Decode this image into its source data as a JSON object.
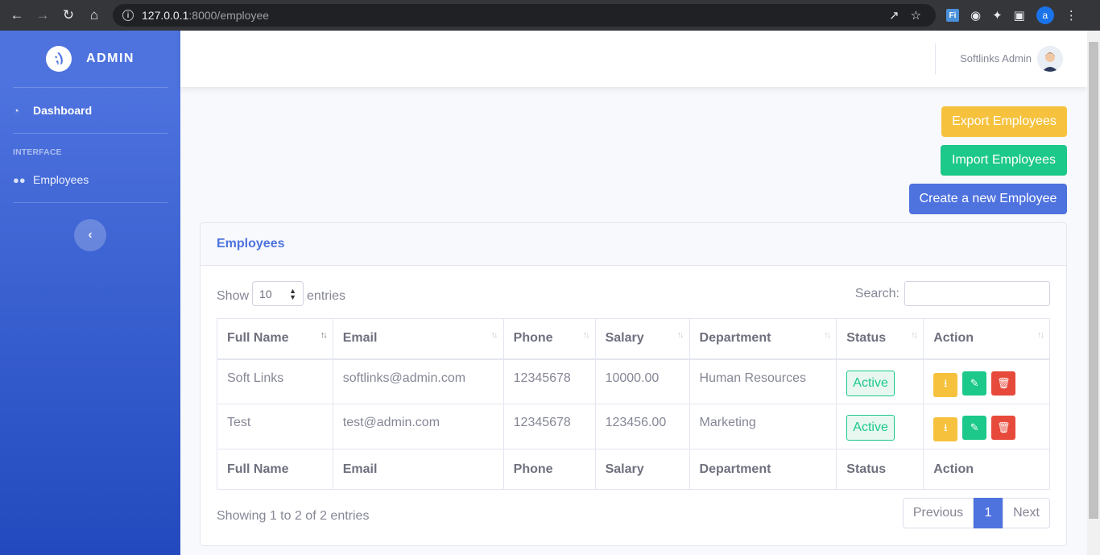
{
  "browser": {
    "url_host": "127.0.0.1",
    "url_path": ":8000/employee"
  },
  "sidebar": {
    "brand": "ADMIN",
    "nav": [
      {
        "label": "Dashboard",
        "icon": "dashboard-icon"
      },
      {
        "label": "Employees",
        "icon": "users-icon"
      }
    ],
    "section_heading": "INTERFACE"
  },
  "topbar": {
    "username": "Softlinks Admin"
  },
  "actions": {
    "export": "Export Employees",
    "import": "Import Employees",
    "create": "Create a new Employee"
  },
  "card": {
    "title": "Employees",
    "show_label": "Show",
    "entries_value": "10",
    "entries_label": "entries",
    "search_label": "Search:"
  },
  "table": {
    "columns": [
      "Full Name",
      "Email",
      "Phone",
      "Salary",
      "Department",
      "Status",
      "Action"
    ],
    "rows": [
      {
        "full_name": "Soft Links",
        "email": "softlinks@admin.com",
        "phone": "12345678",
        "salary": "10000.00",
        "department": "Human Resources",
        "status": "Active"
      },
      {
        "full_name": "Test",
        "email": "test@admin.com",
        "phone": "12345678",
        "salary": "123456.00",
        "department": "Marketing",
        "status": "Active"
      }
    ]
  },
  "footer": {
    "info": "Showing 1 to 2 of 2 entries",
    "previous": "Previous",
    "page": "1",
    "next": "Next"
  },
  "colors": {
    "primary": "#4e73df",
    "success": "#1cc88a",
    "warning": "#f6c23e",
    "danger": "#e74a3b"
  }
}
